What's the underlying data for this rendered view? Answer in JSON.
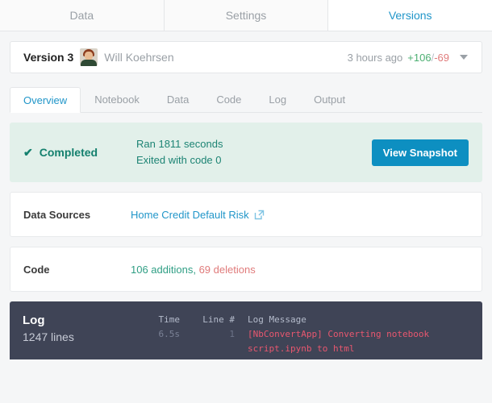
{
  "top_tabs": [
    {
      "label": "Data",
      "active": false
    },
    {
      "label": "Settings",
      "active": false
    },
    {
      "label": "Versions",
      "active": true
    }
  ],
  "version_header": {
    "version_label": "Version 3",
    "author": "Will Koehrsen",
    "avatar_alt": "user-avatar",
    "time_ago": "3 hours ago",
    "additions": "+106",
    "separator": "/",
    "deletions": "-69",
    "expand_icon": "chevron-down-icon"
  },
  "sub_tabs": [
    {
      "label": "Overview",
      "active": true
    },
    {
      "label": "Notebook",
      "active": false
    },
    {
      "label": "Data",
      "active": false
    },
    {
      "label": "Code",
      "active": false
    },
    {
      "label": "Log",
      "active": false
    },
    {
      "label": "Output",
      "active": false
    }
  ],
  "status": {
    "check_icon": "✔",
    "state": "Completed",
    "runtime": "Ran 1811 seconds",
    "exit": "Exited with code 0",
    "button_label": "View Snapshot"
  },
  "data_sources": {
    "label": "Data Sources",
    "link_text": "Home Credit Default Risk",
    "link_icon": "external-link-icon"
  },
  "code": {
    "label": "Code",
    "additions": "106 additions",
    "separator": ", ",
    "deletions": "69 deletions"
  },
  "log": {
    "title": "Log",
    "line_count": "1247 lines",
    "columns": {
      "time": "Time",
      "line": "Line #",
      "message": "Log Message"
    },
    "rows": [
      {
        "time": "6.5s",
        "line": "1",
        "message_line1": "[NbConvertApp] Converting notebook",
        "message_line2": "script.ipynb to html"
      }
    ]
  },
  "colors": {
    "accent_blue": "#2196c9",
    "button_blue": "#0d8fc1",
    "status_green": "#14806e",
    "status_bg": "#e2f0ea",
    "addition_green": "#2f9e84",
    "deletion_red": "#e07b7b",
    "log_bg": "#3f4456",
    "log_message_red": "#e8576f",
    "page_bg": "#f5f6f7"
  }
}
